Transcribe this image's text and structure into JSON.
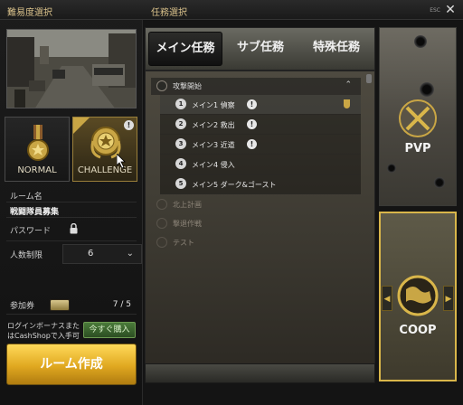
{
  "left_panel": {
    "title": "難易度選択",
    "difficulties": [
      {
        "label": "NORMAL"
      },
      {
        "label": "CHALLENGE"
      }
    ],
    "form": {
      "room_name_label": "ルーム名",
      "room_name_value": "戦闘隊員募集",
      "password_label": "パスワード",
      "players_label": "人数制限",
      "players_value": "6"
    },
    "ticket": {
      "label": "参加券",
      "count": "7 / 5"
    },
    "bonus_text": "ログインボーナスまたはCashShopで入手可",
    "buy_label": "今すぐ購入",
    "create_label": "ルーム作成"
  },
  "right_panel": {
    "title": "任務選択",
    "esc_label": "ESC",
    "close_symbol": "✕",
    "tabs": [
      {
        "label": "メイン任務"
      },
      {
        "label": "サブ任務"
      },
      {
        "label": "特殊任務"
      }
    ],
    "groups": [
      {
        "label": "攻撃開始"
      },
      {
        "label": "北上計画"
      },
      {
        "label": "撃退作戦"
      },
      {
        "label": "テスト"
      }
    ],
    "missions": [
      {
        "num": "1",
        "label": "メイン1 偵察",
        "warn": "!"
      },
      {
        "num": "2",
        "label": "メイン2 救出",
        "warn": "!"
      },
      {
        "num": "3",
        "label": "メイン3 近道",
        "warn": "!"
      },
      {
        "num": "4",
        "label": "メイン4 侵入"
      },
      {
        "num": "5",
        "label": "メイン5 ダーク&ゴースト"
      }
    ],
    "modes": [
      {
        "label": "PVP"
      },
      {
        "label": "COOP"
      }
    ]
  },
  "colors": {
    "accent_gold": "#d9b64a",
    "buy_green": "#4a7a3a"
  }
}
